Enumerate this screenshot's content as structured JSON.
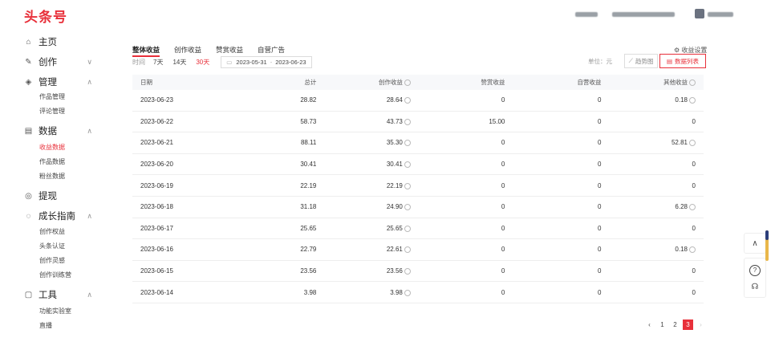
{
  "logo": "头条号",
  "sidebar": {
    "items": [
      {
        "label": "主页",
        "icon": "home-icon",
        "glyph": "⌂",
        "chev": ""
      },
      {
        "label": "创作",
        "icon": "pen-icon",
        "glyph": "✎",
        "chev": "∨"
      },
      {
        "label": "管理",
        "icon": "layers-icon",
        "glyph": "◈",
        "chev": "∧"
      },
      {
        "label": "数据",
        "icon": "chart-icon",
        "glyph": "▤",
        "chev": "∧"
      },
      {
        "label": "提现",
        "icon": "coin-icon",
        "glyph": "◎",
        "chev": ""
      },
      {
        "label": "成长指南",
        "icon": "growth-icon",
        "glyph": "◌",
        "chev": "∧"
      },
      {
        "label": "工具",
        "icon": "toolbox-icon",
        "glyph": "▢",
        "chev": "∧"
      }
    ],
    "sub": {
      "manage": [
        "作品管理",
        "评论管理"
      ],
      "data": [
        "收益数据",
        "作品数据",
        "粉丝数据"
      ],
      "growth": [
        "创作权益",
        "头条认证",
        "创作灵感",
        "创作训练营"
      ],
      "tools": [
        "功能实验室",
        "直播"
      ]
    }
  },
  "main": {
    "tabs": [
      "整体收益",
      "创作收益",
      "赞赏收益",
      "自营广告"
    ],
    "settings_label": "收益设置",
    "range_label": "时间",
    "range_options": [
      "7天",
      "14天",
      "30天"
    ],
    "date_start": "2023-05-31",
    "date_sep": "-",
    "date_end": "2023-06-23",
    "unit_label": "单位：元",
    "trend_button": "趋势图",
    "list_button": "数据列表",
    "columns": [
      "日期",
      "总计",
      "创作收益",
      "赞赏收益",
      "自营收益",
      "其他收益"
    ],
    "rows": [
      {
        "date": "2023-06-23",
        "total": "28.82",
        "create": "28.64",
        "reward": "0",
        "self": "0",
        "other": "0.18"
      },
      {
        "date": "2023-06-22",
        "total": "58.73",
        "create": "43.73",
        "reward": "15.00",
        "self": "0",
        "other": "0"
      },
      {
        "date": "2023-06-21",
        "total": "88.11",
        "create": "35.30",
        "reward": "0",
        "self": "0",
        "other": "52.81"
      },
      {
        "date": "2023-06-20",
        "total": "30.41",
        "create": "30.41",
        "reward": "0",
        "self": "0",
        "other": "0"
      },
      {
        "date": "2023-06-19",
        "total": "22.19",
        "create": "22.19",
        "reward": "0",
        "self": "0",
        "other": "0"
      },
      {
        "date": "2023-06-18",
        "total": "31.18",
        "create": "24.90",
        "reward": "0",
        "self": "0",
        "other": "6.28"
      },
      {
        "date": "2023-06-17",
        "total": "25.65",
        "create": "25.65",
        "reward": "0",
        "self": "0",
        "other": "0"
      },
      {
        "date": "2023-06-16",
        "total": "22.79",
        "create": "22.61",
        "reward": "0",
        "self": "0",
        "other": "0.18"
      },
      {
        "date": "2023-06-15",
        "total": "23.56",
        "create": "23.56",
        "reward": "0",
        "self": "0",
        "other": "0"
      },
      {
        "date": "2023-06-14",
        "total": "3.98",
        "create": "3.98",
        "reward": "0",
        "self": "0",
        "other": "0"
      }
    ],
    "pager": {
      "prev": "‹",
      "pages": [
        "1",
        "2",
        "3"
      ],
      "active": "3",
      "next": "›"
    }
  },
  "float": {
    "top": "∧",
    "help": "?",
    "support": "☊"
  },
  "colors": {
    "brand": "#e8303a"
  }
}
